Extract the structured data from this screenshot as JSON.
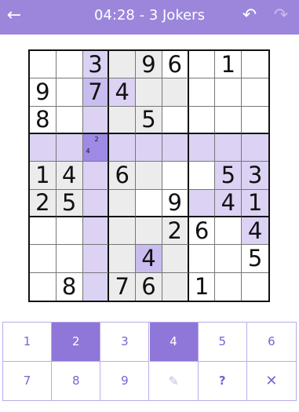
{
  "header": {
    "title": "04:28 - 3 Jokers",
    "back_icon": "←",
    "undo_icon": "↶",
    "redo_icon": "↷"
  },
  "grid": {
    "rows": [
      [
        "",
        "",
        "3",
        "",
        "9",
        "6",
        "",
        "1",
        ""
      ],
      [
        "9",
        "",
        "7",
        "4",
        "",
        "",
        "",
        "",
        ""
      ],
      [
        "8",
        "",
        "",
        "",
        "5",
        "",
        "",
        "",
        ""
      ],
      [
        "",
        "",
        "",
        "",
        "",
        "",
        "",
        "",
        ""
      ],
      [
        "1",
        "4",
        "",
        "6",
        "",
        "",
        "",
        "5",
        "3"
      ],
      [
        "2",
        "5",
        "",
        "",
        "",
        "9",
        "",
        "4",
        "1"
      ],
      [
        "",
        "",
        "",
        "",
        "",
        "2",
        "6",
        "",
        "4"
      ],
      [
        "",
        "",
        "",
        "",
        "4",
        "",
        "",
        "",
        "5"
      ],
      [
        "",
        "8",
        "",
        "7",
        "6",
        "",
        "1",
        "",
        ""
      ]
    ],
    "shading": [
      "wwlggwwww",
      "wwdlggwww",
      "wwlggwwww",
      "lllllllll",
      "gglggwwll",
      "gglgwwlll",
      "wwlgggwwl",
      "wwlgdgwww",
      "wwlgggwww"
    ],
    "notes": {
      "row": 3,
      "col": 2,
      "values": [
        "4",
        "2"
      ]
    }
  },
  "keypad": {
    "keys": [
      {
        "label": "1",
        "active": false,
        "name": "digit-1-button"
      },
      {
        "label": "2",
        "active": true,
        "name": "digit-2-button"
      },
      {
        "label": "3",
        "active": false,
        "name": "digit-3-button"
      },
      {
        "label": "4",
        "active": true,
        "name": "digit-4-button"
      },
      {
        "label": "5",
        "active": false,
        "name": "digit-5-button"
      },
      {
        "label": "6",
        "active": false,
        "name": "digit-6-button"
      },
      {
        "label": "7",
        "active": false,
        "name": "digit-7-button"
      },
      {
        "label": "8",
        "active": false,
        "name": "digit-8-button"
      },
      {
        "label": "9",
        "active": false,
        "name": "digit-9-button"
      },
      {
        "label": "✎",
        "active": false,
        "name": "pencil-button",
        "icon": "pencil-icon"
      },
      {
        "label": "?",
        "active": false,
        "name": "hint-button"
      },
      {
        "label": "✕",
        "active": false,
        "name": "erase-button",
        "icon": "close-icon"
      }
    ]
  },
  "colors": {
    "accent": "#9b86dc",
    "selected_cell": "#9f8ae6",
    "highlight": "#dcd2f4",
    "peer": "#ececec"
  }
}
